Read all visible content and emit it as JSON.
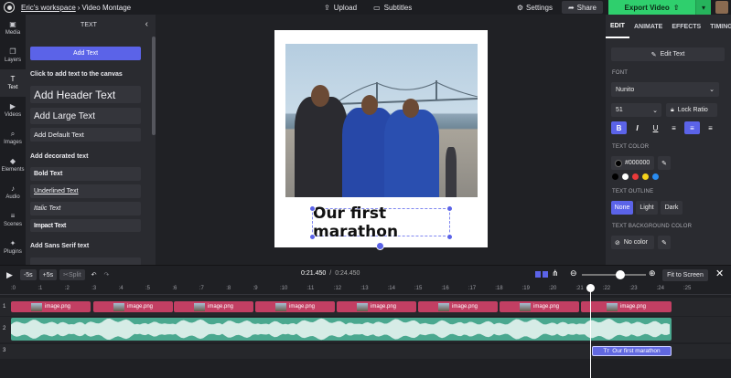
{
  "topbar": {
    "workspace": "Eric's workspace",
    "separator": "›",
    "project": "Video Montage",
    "upload": "Upload",
    "subtitles": "Subtitles",
    "settings": "Settings",
    "share": "Share",
    "export": "Export Video"
  },
  "rail": [
    {
      "label": "Media",
      "icon": "▣"
    },
    {
      "label": "Layers",
      "icon": "❐"
    },
    {
      "label": "Text",
      "icon": "T"
    },
    {
      "label": "Videos",
      "icon": "▶"
    },
    {
      "label": "Images",
      "icon": "⌕"
    },
    {
      "label": "Elements",
      "icon": "◆"
    },
    {
      "label": "Audio",
      "icon": "♪"
    },
    {
      "label": "Scenes",
      "icon": "≡"
    },
    {
      "label": "Plugins",
      "icon": "✦"
    }
  ],
  "text_panel": {
    "title": "TEXT",
    "add_button": "Add Text",
    "click_label": "Click to add text to the canvas",
    "header_text": "Add Header Text",
    "large_text": "Add Large Text",
    "default_text": "Add Default Text",
    "decorated_label": "Add decorated text",
    "bold_text": "Bold Text",
    "underlined_text": "Underlined Text",
    "italic_text": "Italic Text",
    "impact_text": "Impact Text",
    "sans_label": "Add Sans Serif text"
  },
  "canvas": {
    "caption": "Our first marathon"
  },
  "right_panel": {
    "tabs": [
      "EDIT",
      "ANIMATE",
      "EFFECTS",
      "TIMING"
    ],
    "edit_text": "Edit Text",
    "font_label": "FONT",
    "font": "Nunito",
    "size": "51",
    "lock_ratio": "Lock Ratio",
    "color_label": "TEXT COLOR",
    "color_value": "#000000",
    "outline_label": "TEXT OUTLINE",
    "outline_none": "None",
    "outline_light": "Light",
    "outline_dark": "Dark",
    "bg_label": "TEXT BACKGROUND COLOR",
    "no_color": "No color",
    "swatches": [
      "#000000",
      "#ffffff",
      "#e83a3a",
      "#f3d21b",
      "#2a8cf0"
    ],
    "accent": "#5b63e8"
  },
  "timeline": {
    "back5": "-5s",
    "fwd5": "+5s",
    "split": "Split",
    "current_time": "0:21.450",
    "total_time": "0:24.450",
    "time_sep": "/",
    "fit": "Fit to Screen",
    "zoom_level": 0.6,
    "ticks": [
      ":0",
      ":1",
      ":2",
      ":3",
      ":4",
      ":5",
      ":6",
      ":7",
      ":8",
      ":9",
      ":10",
      ":11",
      ":12",
      ":13",
      ":14",
      ":15",
      ":16",
      ":17",
      ":18",
      ":19",
      ":20",
      ":21",
      ":22",
      ":23",
      ":24",
      ":25"
    ],
    "track_numbers": [
      "1",
      "2",
      "3"
    ],
    "clip_label": "image.png",
    "text_clip": "Our first marathon"
  }
}
